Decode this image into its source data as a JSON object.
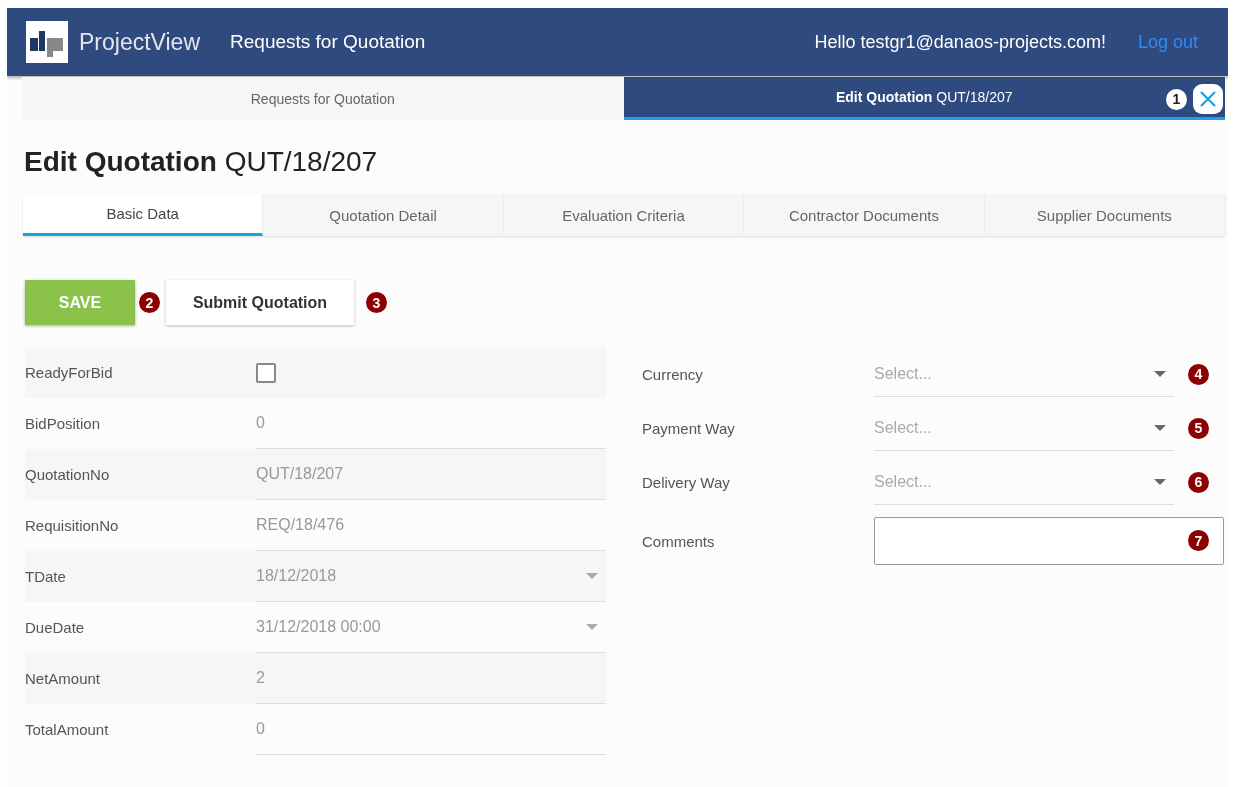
{
  "header": {
    "app_name": "ProjectView",
    "section": "Requests for Quotation",
    "greeting": "Hello testgr1@danaos-projects.com!",
    "logout": "Log out"
  },
  "page_tabs": [
    {
      "label": "Requests for Quotation",
      "selected": false
    },
    {
      "label": "**Edit Quotation** QUT/18/207",
      "selected": true,
      "callout": "1",
      "closable": true
    }
  ],
  "title": "**Edit Quotation** QUT/18/207",
  "tabs": [
    {
      "label": "Basic Data",
      "selected": true
    },
    {
      "label": "Quotation Detail",
      "selected": false
    },
    {
      "label": "Evaluation Criteria",
      "selected": false
    },
    {
      "label": "Contractor Documents",
      "selected": false
    },
    {
      "label": "Supplier Documents",
      "selected": false
    }
  ],
  "actions": [
    {
      "label": "SAVE",
      "kind": "primary",
      "callout": "2"
    },
    {
      "label": "Submit Quotation",
      "kind": "secondary",
      "callout": "3"
    }
  ],
  "left_fields": [
    {
      "label": "ReadyForBid",
      "kind": "checkbox",
      "checked": false
    },
    {
      "label": "BidPosition",
      "kind": "text",
      "value": "0"
    },
    {
      "label": "QuotationNo",
      "kind": "text",
      "value": "QUT/18/207"
    },
    {
      "label": "RequisitionNo",
      "kind": "text",
      "value": "REQ/18/476"
    },
    {
      "label": "TDate",
      "kind": "date",
      "value": "18/12/2018"
    },
    {
      "label": "DueDate",
      "kind": "date",
      "value": "31/12/2018 00:00"
    },
    {
      "label": "NetAmount",
      "kind": "text",
      "value": "2"
    },
    {
      "label": "TotalAmount",
      "kind": "text",
      "value": "0"
    }
  ],
  "right_fields": [
    {
      "label": "Currency",
      "kind": "select",
      "placeholder": "Select...",
      "callout": "4"
    },
    {
      "label": "Payment Way",
      "kind": "select",
      "placeholder": "Select...",
      "callout": "5"
    },
    {
      "label": "Delivery Way",
      "kind": "select",
      "placeholder": "Select...",
      "callout": "6"
    },
    {
      "label": "Comments",
      "kind": "textarea",
      "callout": "7"
    }
  ]
}
